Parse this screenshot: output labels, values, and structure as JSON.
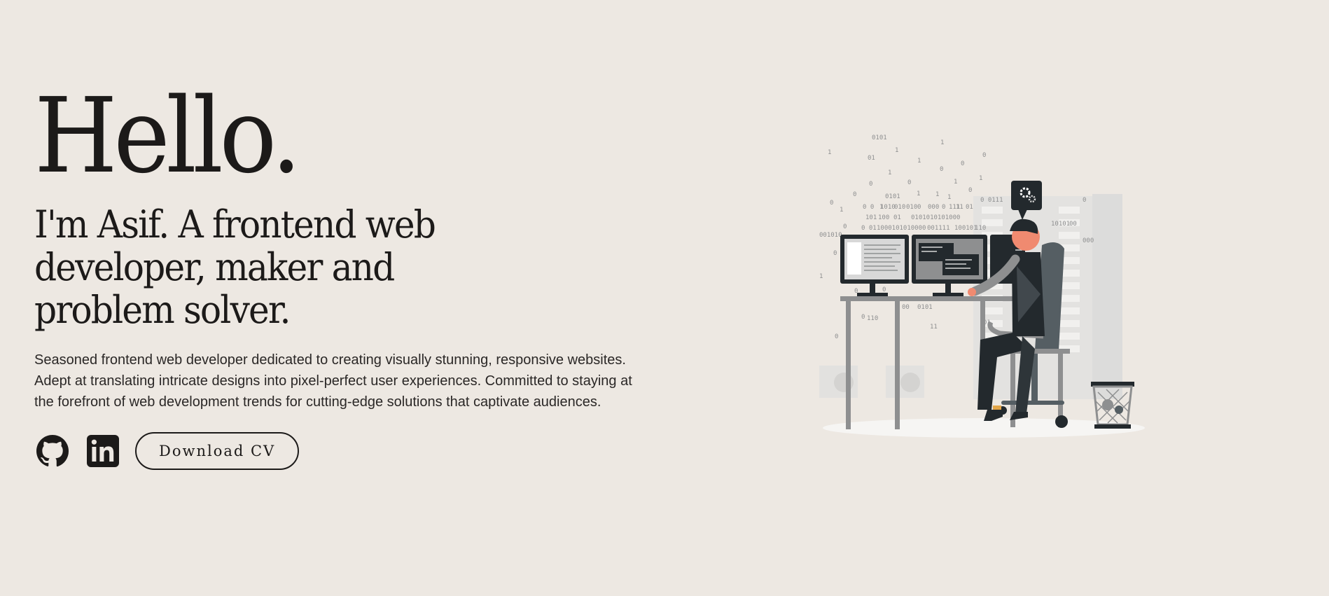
{
  "hero": {
    "greeting": "Hello.",
    "tagline": "I'm Asif. A frontend web developer, maker and problem solver.",
    "bio": "Seasoned frontend web developer dedicated to creating visually stunning, responsive websites. Adept at translating intricate designs into pixel-perfect user experiences. Committed to staying at the forefront of web development trends for cutting-edge solutions that captivate audiences."
  },
  "actions": {
    "github_icon": "github-icon",
    "linkedin_icon": "linkedin-icon",
    "download_cv_label": "Download CV"
  },
  "illustration": {
    "binary_digits": [
      "0101",
      "1",
      "01",
      "1",
      "1",
      "0",
      "0",
      "1",
      "0",
      "1",
      "0",
      "0",
      "1",
      "1",
      "0",
      "0101",
      "1",
      "1",
      "1",
      "0 0111",
      "1",
      "0",
      "0",
      "1",
      "0 0",
      "1010",
      "010",
      "010",
      "0",
      "000",
      "0",
      "111",
      "11",
      "01",
      "101",
      "100",
      "01",
      "0101010101000",
      "0",
      "10101",
      "00",
      "0",
      "0 01",
      "1000101010000",
      "001111",
      "100101",
      "110",
      "001010",
      "0",
      "0",
      "1",
      "0",
      "0",
      "0",
      "000",
      "00",
      "0101",
      "0",
      "110",
      "11",
      "01",
      "0"
    ],
    "colors": {
      "dark": "#23292d",
      "mid": "#8e8f90",
      "light": "#d8d8d8",
      "skin": "#f08a70",
      "shoe_accent": "#e2a548"
    }
  }
}
